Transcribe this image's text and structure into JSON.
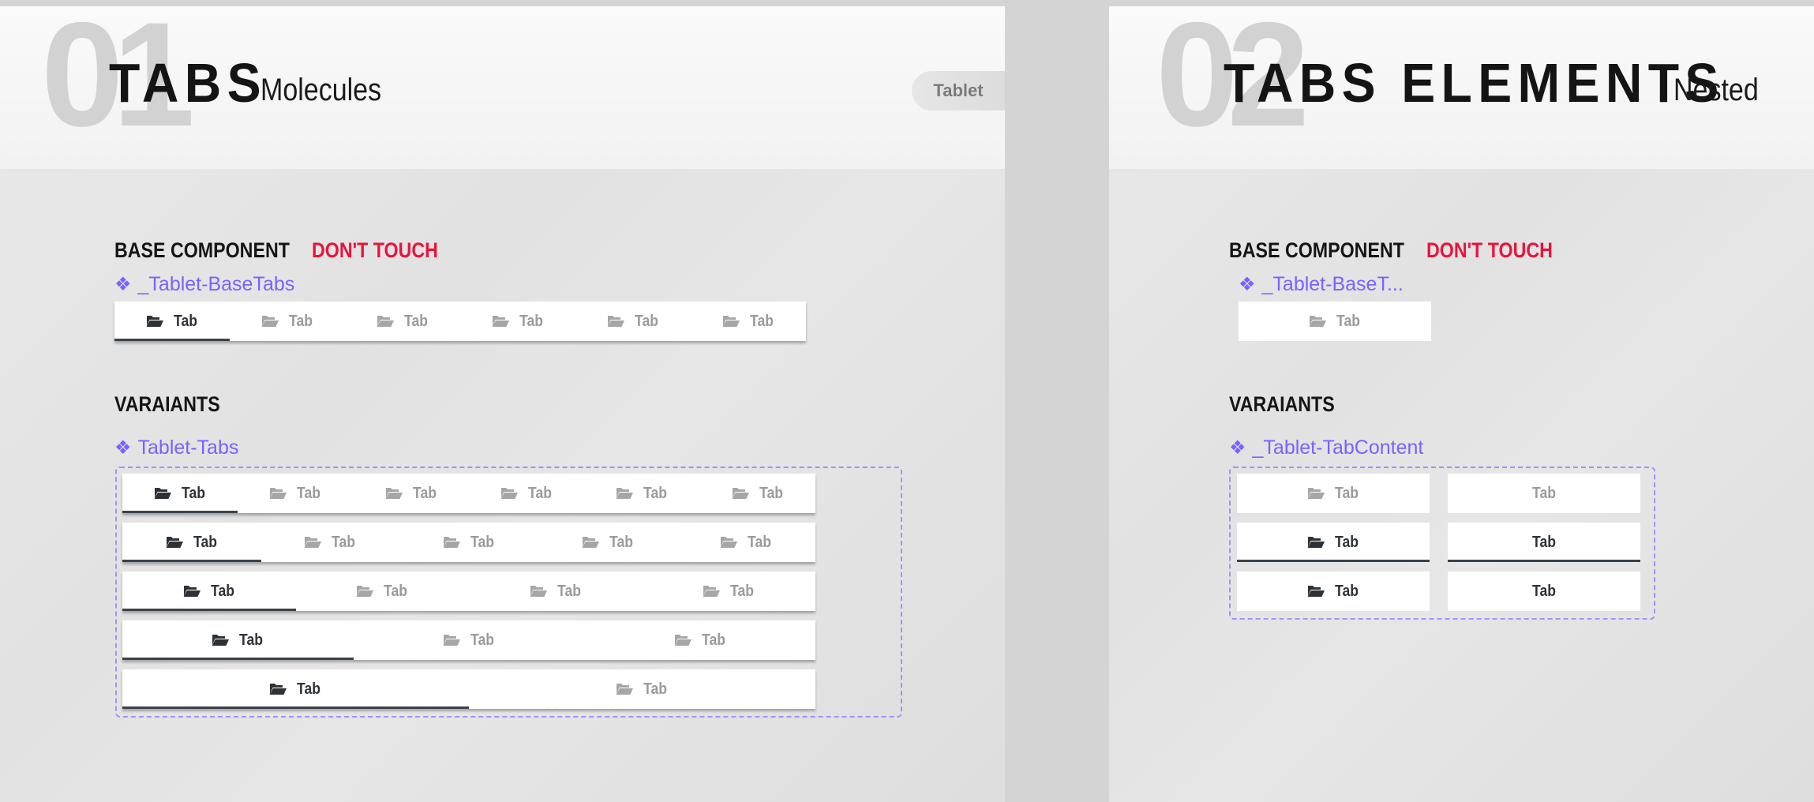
{
  "board1": {
    "number": "01",
    "title": "TABS",
    "subtitle": "Molecules",
    "badge": "Tablet",
    "base_heading": "BASE COMPONENT",
    "warning": "DON'T TOUCH",
    "base_component_name": "_Tablet-BaseTabs",
    "base_tabs": [
      "Tab",
      "Tab",
      "Tab",
      "Tab",
      "Tab",
      "Tab"
    ],
    "variants_heading": "VARAIANTS",
    "variants_component_name": "Tablet-Tabs",
    "variant_rows": [
      {
        "tabs": [
          "Tab",
          "Tab",
          "Tab",
          "Tab",
          "Tab",
          "Tab"
        ]
      },
      {
        "tabs": [
          "Tab",
          "Tab",
          "Tab",
          "Tab",
          "Tab"
        ]
      },
      {
        "tabs": [
          "Tab",
          "Tab",
          "Tab",
          "Tab"
        ]
      },
      {
        "tabs": [
          "Tab",
          "Tab",
          "Tab"
        ]
      },
      {
        "tabs": [
          "Tab",
          "Tab"
        ]
      }
    ]
  },
  "board2": {
    "number": "02",
    "title": "TABS ELEMENTS",
    "subtitle": "Nested",
    "base_heading": "BASE COMPONENT",
    "warning": "DON'T TOUCH",
    "base_component_name": "_Tablet-BaseT...",
    "base_tab": "Tab",
    "variants_heading": "VARAIANTS",
    "variants_component_name": "_Tablet-TabContent",
    "content_cells": [
      {
        "label": "Tab",
        "icon": true,
        "state": "default"
      },
      {
        "label": "Tab",
        "icon": false,
        "state": "default"
      },
      {
        "label": "Tab",
        "icon": true,
        "state": "active"
      },
      {
        "label": "Tab",
        "icon": false,
        "state": "active"
      },
      {
        "label": "Tab",
        "icon": true,
        "state": "hover"
      },
      {
        "label": "Tab",
        "icon": false,
        "state": "hover"
      }
    ]
  },
  "icons": {
    "tab_icon": "folder-open-icon",
    "component_icon": "component-diamond-icon"
  },
  "colors": {
    "accent": "#7b61ff",
    "warning": "#e8143c",
    "active_text": "#2d3238",
    "inactive_text": "#9a9a9a"
  }
}
